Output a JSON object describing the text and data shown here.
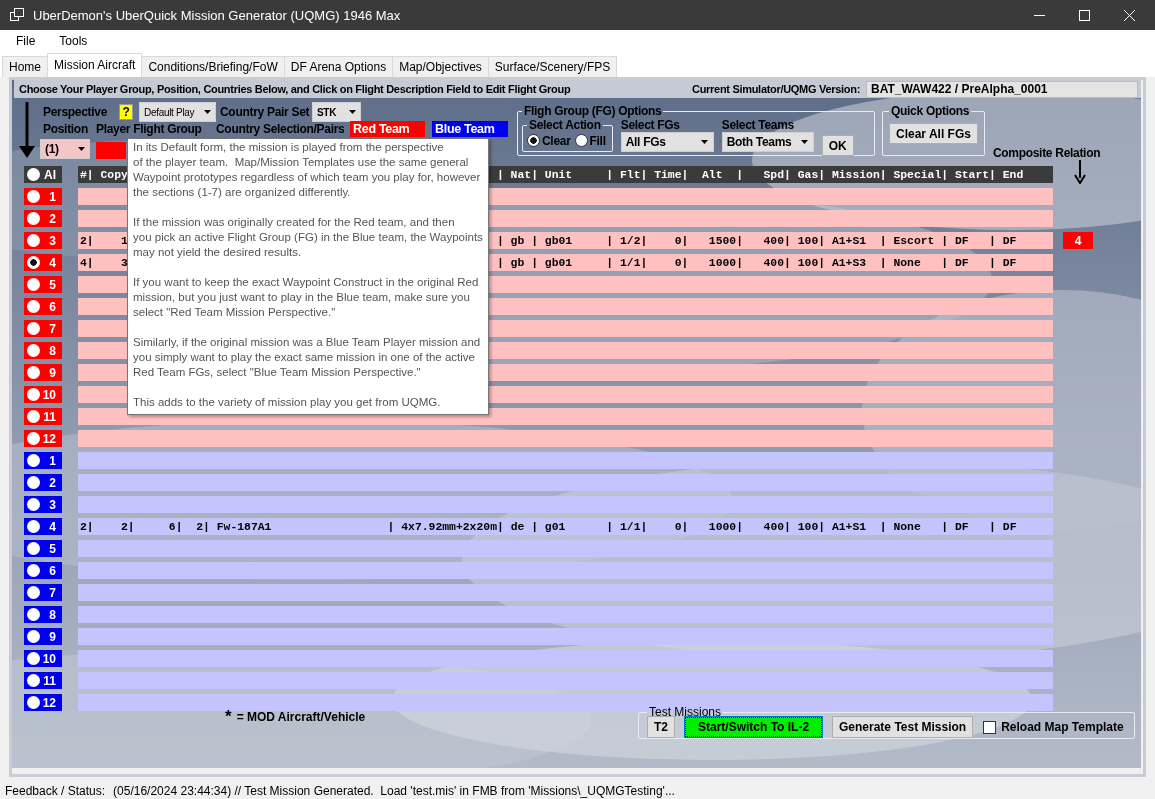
{
  "window": {
    "title": "UberDemon's UberQuick Mission Generator (UQMG) 1946 Max"
  },
  "menu": [
    "File",
    "Tools"
  ],
  "tabs": [
    {
      "label": "Home",
      "selected": false
    },
    {
      "label": "Mission Aircraft",
      "selected": true
    },
    {
      "label": "Conditions/Briefing/FoW",
      "selected": false
    },
    {
      "label": "DF Arena Options",
      "selected": false
    },
    {
      "label": "Map/Objectives",
      "selected": false
    },
    {
      "label": "Surface/Scenery/FPS",
      "selected": false
    }
  ],
  "header": {
    "instruction": "Choose Your Player Group, Position, Countries Below, and Click on Flight Description Field to Edit Flight Group",
    "version_label": "Current Simulator/UQMG Version:",
    "version_value": "BAT_WAW422 / PreAlpha_0001"
  },
  "player_setup": {
    "perspective_label": "Perspective",
    "help_badge": "?",
    "perspective_value": "Default Play",
    "country_pair_label": "Country Pair Set",
    "country_pair_value": "STK",
    "position_label": "Position",
    "flight_group_label": "Player Flight Group",
    "country_selection_label": "Country Selection/Pairs",
    "red_team": "Red Team",
    "blue_team": "Blue Team",
    "position_value": "(1)"
  },
  "fg_options": {
    "title": "Fligh Group (FG) Options",
    "select_action": {
      "title": "Select Action",
      "options": [
        {
          "label": "Clear",
          "selected": true
        },
        {
          "label": "Fill",
          "selected": false
        }
      ]
    },
    "select_fgs_label": "Select FGs",
    "select_fgs_value": "All FGs",
    "select_teams_label": "Select Teams",
    "select_teams_value": "Both Teams",
    "ok_button": "OK"
  },
  "quick_options": {
    "title": "Quick Options",
    "button": "Clear All FGs"
  },
  "composite_relation": {
    "label": "Composite Relation"
  },
  "table": {
    "all_label": "AI",
    "all_selected": false,
    "header_segments": [
      "#| Copy",
      "| Nat| Unit     | Flt| Time|  Alt  |   Spd| Gas| Mission| Special| Start| End"
    ],
    "rows": [
      {
        "kind": "red",
        "number": "1",
        "selected": false
      },
      {
        "kind": "red",
        "number": "2",
        "selected": false
      },
      {
        "kind": "red",
        "number": "3",
        "selected": false,
        "segments": [
          "2|    1",
          "| gb | gb01     | 1/2|    0|   1500|   400| 100| A1+S1  | Escort | DF   | DF"
        ],
        "composite": "4"
      },
      {
        "kind": "red",
        "number": "4",
        "selected": true,
        "segments": [
          "4|    3",
          "| gb | gb01     | 1/1|    0|   1000|   400| 100| A1+S3  | None   | DF   | DF"
        ]
      },
      {
        "kind": "red",
        "number": "5",
        "selected": false
      },
      {
        "kind": "red",
        "number": "6",
        "selected": false
      },
      {
        "kind": "red",
        "number": "7",
        "selected": false
      },
      {
        "kind": "red",
        "number": "8",
        "selected": false
      },
      {
        "kind": "red",
        "number": "9",
        "selected": false
      },
      {
        "kind": "red",
        "number": "10",
        "selected": false
      },
      {
        "kind": "red",
        "number": "11",
        "selected": false
      },
      {
        "kind": "red",
        "number": "12",
        "selected": false
      },
      {
        "kind": "blue",
        "number": "1",
        "selected": false
      },
      {
        "kind": "blue",
        "number": "2",
        "selected": false
      },
      {
        "kind": "blue",
        "number": "3",
        "selected": false
      },
      {
        "kind": "blue",
        "number": "4",
        "selected": false,
        "segments": [
          "2|    2|     6|  2| Fw-187A1                 | 4x7.92mm+2x20m| de | g01      | 1/1|    0|   1000|   400| 100| A1+S1  | None   | DF   | DF"
        ]
      },
      {
        "kind": "blue",
        "number": "5",
        "selected": false
      },
      {
        "kind": "blue",
        "number": "6",
        "selected": false
      },
      {
        "kind": "blue",
        "number": "7",
        "selected": false
      },
      {
        "kind": "blue",
        "number": "8",
        "selected": false
      },
      {
        "kind": "blue",
        "number": "9",
        "selected": false
      },
      {
        "kind": "blue",
        "number": "10",
        "selected": false
      },
      {
        "kind": "blue",
        "number": "11",
        "selected": false
      },
      {
        "kind": "blue",
        "number": "12",
        "selected": false
      }
    ]
  },
  "legend": {
    "symbol": "*",
    "text": "= MOD Aircraft/Vehicle"
  },
  "test_missions": {
    "title": "Test Missions",
    "t2_button": "T2",
    "start_button": "Start/Switch To IL-2",
    "generate_button": "Generate Test Mission",
    "reload_label": "Reload Map Template",
    "reload_checked": false
  },
  "tooltip": {
    "paragraphs": [
      "In its Default form, the mission is played from the perspective\nof the player team.  Map/Mission Templates use the same general\nWaypoint prototypes regardless of which team you play for, however\nthe sections (1-7) are organized differently.",
      "If the mission was originally created for the Red team, and then\nyou pick an active Flight Group (FG) in the Blue team, the Waypoints\nmay not yield the desired results.",
      "If you want to keep the exact Waypoint Construct in the original Red\nmission, but you just want to play in the Blue team, make sure you\nselect \"Red Team Mission Perspective.\"",
      "Similarly, if the original mission was a Blue Team Player mission and\nyou simply want to play the exact same mission in one of the active\nRed Team FGs, select \"Blue Team Mission Perspective.\"",
      "This adds to the variety of mission play you get from UQMG."
    ]
  },
  "status_bar": {
    "label": "Feedback / Status:",
    "message": "(05/16/2024 23:44:34) // Test Mission Generated.  Load 'test.mis' in FMB from 'Missions\\_UQMGTesting'..."
  }
}
